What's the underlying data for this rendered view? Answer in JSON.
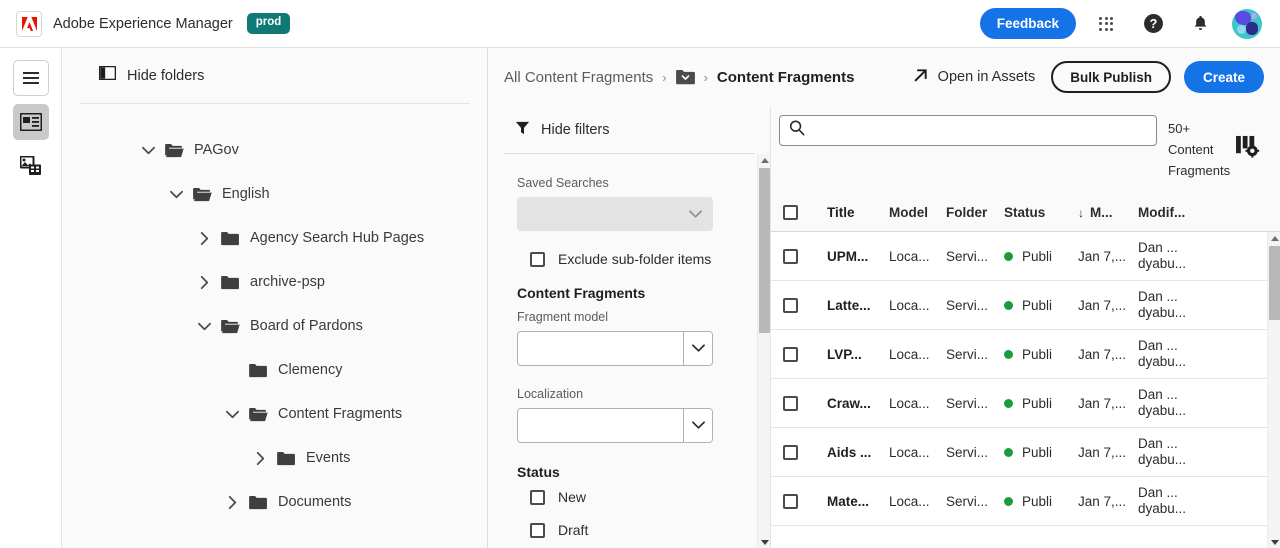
{
  "topbar": {
    "logo_icon": "adobe-logo-icon",
    "app_title": "Adobe Experience Manager",
    "env_badge": "prod",
    "feedback_label": "Feedback",
    "apps_icon": "app-grid-icon",
    "help_icon": "help-icon",
    "notifications_icon": "bell-icon",
    "avatar_icon": "user-avatar",
    "feedback_color": "#1473e6",
    "badge_color": "#0f7a75"
  },
  "rail": {
    "menu_icon": "hamburger-menu-icon",
    "content_fragments_icon": "content-fragments-icon",
    "assets_icon": "assets-icon"
  },
  "tree": {
    "hide_folders_label": "Hide folders",
    "panel_icon": "panel-toggle-icon",
    "items": [
      {
        "label": "PAGov",
        "depth": 0,
        "expanded": true,
        "chevron": "down",
        "leaf": false
      },
      {
        "label": "English",
        "depth": 1,
        "expanded": true,
        "chevron": "down",
        "leaf": false
      },
      {
        "label": "Agency Search Hub Pages",
        "depth": 2,
        "expanded": false,
        "chevron": "right",
        "leaf": false
      },
      {
        "label": "archive-psp",
        "depth": 2,
        "expanded": false,
        "chevron": "right",
        "leaf": false
      },
      {
        "label": "Board of Pardons",
        "depth": 2,
        "expanded": true,
        "chevron": "down",
        "leaf": false
      },
      {
        "label": "Clemency",
        "depth": 3,
        "expanded": false,
        "chevron": "none",
        "leaf": true
      },
      {
        "label": "Content Fragments",
        "depth": 3,
        "expanded": true,
        "chevron": "down",
        "leaf": false
      },
      {
        "label": "Events",
        "depth": 4,
        "expanded": false,
        "chevron": "right",
        "leaf": false
      },
      {
        "label": "Documents",
        "depth": 3,
        "expanded": false,
        "chevron": "right",
        "leaf": false
      }
    ]
  },
  "breadcrumb": {
    "root": "All Content Fragments",
    "separator": "›",
    "folder_icon": "folder-dropdown-icon",
    "current": "Content Fragments"
  },
  "actions": {
    "open_in_assets_label": "Open in Assets",
    "open_in_assets_icon": "open-external-icon",
    "bulk_publish_label": "Bulk Publish",
    "create_label": "Create"
  },
  "filters": {
    "hide_filters_label": "Hide filters",
    "filter_icon": "filter-funnel-icon",
    "saved_searches_label": "Saved Searches",
    "saved_searches_value": "",
    "exclude_subfolder_label": "Exclude sub-folder items",
    "exclude_subfolder_checked": false,
    "content_fragments_title": "Content Fragments",
    "fragment_model_label": "Fragment model",
    "fragment_model_value": "",
    "localization_label": "Localization",
    "localization_value": "",
    "status_title": "Status",
    "status_options": [
      {
        "label": "New",
        "checked": false
      },
      {
        "label": "Draft",
        "checked": false
      }
    ]
  },
  "search": {
    "value": "",
    "placeholder": "",
    "search_icon": "search-icon"
  },
  "results": {
    "count": "50+",
    "count_line2": "Content",
    "count_line3": "Fragments",
    "column_settings_icon": "column-settings-icon"
  },
  "table": {
    "select_all_checked": false,
    "sort_indicator": "↓",
    "columns": [
      "Title",
      "Model",
      "Folder",
      "Status",
      "M...",
      "Modif..."
    ],
    "rows": [
      {
        "checked": false,
        "title": "UPM...",
        "model": "Loca...",
        "folder": "Servi...",
        "status": "Publi",
        "status_color": "#1a9c3e",
        "modified": "Jan 7,...",
        "by_name": "Dan ...",
        "by_user": "dyabu..."
      },
      {
        "checked": false,
        "title": "Latte...",
        "model": "Loca...",
        "folder": "Servi...",
        "status": "Publi",
        "status_color": "#1a9c3e",
        "modified": "Jan 7,...",
        "by_name": "Dan ...",
        "by_user": "dyabu..."
      },
      {
        "checked": false,
        "title": "LVP...",
        "model": "Loca...",
        "folder": "Servi...",
        "status": "Publi",
        "status_color": "#1a9c3e",
        "modified": "Jan 7,...",
        "by_name": "Dan ...",
        "by_user": "dyabu..."
      },
      {
        "checked": false,
        "title": "Craw...",
        "model": "Loca...",
        "folder": "Servi...",
        "status": "Publi",
        "status_color": "#1a9c3e",
        "modified": "Jan 7,...",
        "by_name": "Dan ...",
        "by_user": "dyabu..."
      },
      {
        "checked": false,
        "title": "Aids ...",
        "model": "Loca...",
        "folder": "Servi...",
        "status": "Publi",
        "status_color": "#1a9c3e",
        "modified": "Jan 7,...",
        "by_name": "Dan ...",
        "by_user": "dyabu..."
      },
      {
        "checked": false,
        "title": "Mate...",
        "model": "Loca...",
        "folder": "Servi...",
        "status": "Publi",
        "status_color": "#1a9c3e",
        "modified": "Jan 7,...",
        "by_name": "Dan ...",
        "by_user": "dyabu..."
      }
    ]
  }
}
